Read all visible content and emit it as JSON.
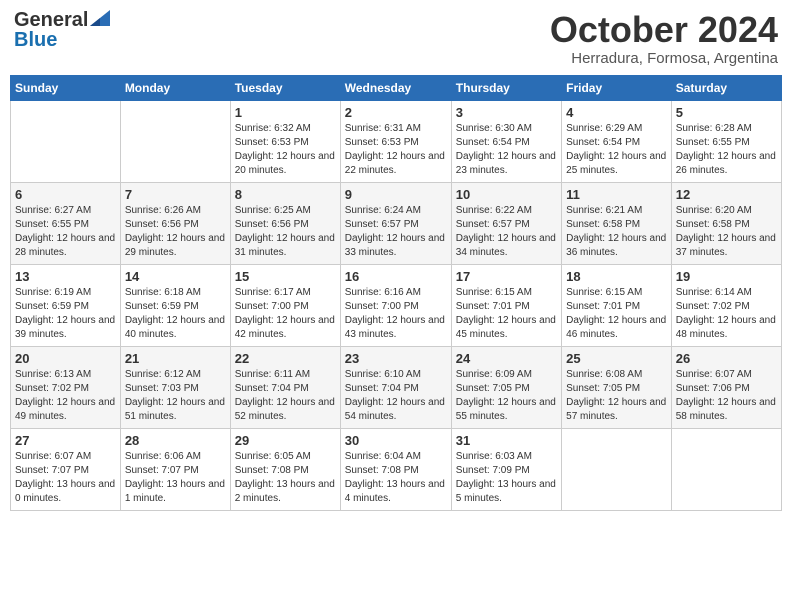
{
  "logo": {
    "general": "General",
    "blue": "Blue"
  },
  "title": "October 2024",
  "location": "Herradura, Formosa, Argentina",
  "weekdays": [
    "Sunday",
    "Monday",
    "Tuesday",
    "Wednesday",
    "Thursday",
    "Friday",
    "Saturday"
  ],
  "weeks": [
    [
      {
        "day": "",
        "empty": true
      },
      {
        "day": "",
        "empty": true
      },
      {
        "day": "1",
        "sunrise": "Sunrise: 6:32 AM",
        "sunset": "Sunset: 6:53 PM",
        "daylight": "Daylight: 12 hours and 20 minutes."
      },
      {
        "day": "2",
        "sunrise": "Sunrise: 6:31 AM",
        "sunset": "Sunset: 6:53 PM",
        "daylight": "Daylight: 12 hours and 22 minutes."
      },
      {
        "day": "3",
        "sunrise": "Sunrise: 6:30 AM",
        "sunset": "Sunset: 6:54 PM",
        "daylight": "Daylight: 12 hours and 23 minutes."
      },
      {
        "day": "4",
        "sunrise": "Sunrise: 6:29 AM",
        "sunset": "Sunset: 6:54 PM",
        "daylight": "Daylight: 12 hours and 25 minutes."
      },
      {
        "day": "5",
        "sunrise": "Sunrise: 6:28 AM",
        "sunset": "Sunset: 6:55 PM",
        "daylight": "Daylight: 12 hours and 26 minutes."
      }
    ],
    [
      {
        "day": "6",
        "sunrise": "Sunrise: 6:27 AM",
        "sunset": "Sunset: 6:55 PM",
        "daylight": "Daylight: 12 hours and 28 minutes."
      },
      {
        "day": "7",
        "sunrise": "Sunrise: 6:26 AM",
        "sunset": "Sunset: 6:56 PM",
        "daylight": "Daylight: 12 hours and 29 minutes."
      },
      {
        "day": "8",
        "sunrise": "Sunrise: 6:25 AM",
        "sunset": "Sunset: 6:56 PM",
        "daylight": "Daylight: 12 hours and 31 minutes."
      },
      {
        "day": "9",
        "sunrise": "Sunrise: 6:24 AM",
        "sunset": "Sunset: 6:57 PM",
        "daylight": "Daylight: 12 hours and 33 minutes."
      },
      {
        "day": "10",
        "sunrise": "Sunrise: 6:22 AM",
        "sunset": "Sunset: 6:57 PM",
        "daylight": "Daylight: 12 hours and 34 minutes."
      },
      {
        "day": "11",
        "sunrise": "Sunrise: 6:21 AM",
        "sunset": "Sunset: 6:58 PM",
        "daylight": "Daylight: 12 hours and 36 minutes."
      },
      {
        "day": "12",
        "sunrise": "Sunrise: 6:20 AM",
        "sunset": "Sunset: 6:58 PM",
        "daylight": "Daylight: 12 hours and 37 minutes."
      }
    ],
    [
      {
        "day": "13",
        "sunrise": "Sunrise: 6:19 AM",
        "sunset": "Sunset: 6:59 PM",
        "daylight": "Daylight: 12 hours and 39 minutes."
      },
      {
        "day": "14",
        "sunrise": "Sunrise: 6:18 AM",
        "sunset": "Sunset: 6:59 PM",
        "daylight": "Daylight: 12 hours and 40 minutes."
      },
      {
        "day": "15",
        "sunrise": "Sunrise: 6:17 AM",
        "sunset": "Sunset: 7:00 PM",
        "daylight": "Daylight: 12 hours and 42 minutes."
      },
      {
        "day": "16",
        "sunrise": "Sunrise: 6:16 AM",
        "sunset": "Sunset: 7:00 PM",
        "daylight": "Daylight: 12 hours and 43 minutes."
      },
      {
        "day": "17",
        "sunrise": "Sunrise: 6:15 AM",
        "sunset": "Sunset: 7:01 PM",
        "daylight": "Daylight: 12 hours and 45 minutes."
      },
      {
        "day": "18",
        "sunrise": "Sunrise: 6:15 AM",
        "sunset": "Sunset: 7:01 PM",
        "daylight": "Daylight: 12 hours and 46 minutes."
      },
      {
        "day": "19",
        "sunrise": "Sunrise: 6:14 AM",
        "sunset": "Sunset: 7:02 PM",
        "daylight": "Daylight: 12 hours and 48 minutes."
      }
    ],
    [
      {
        "day": "20",
        "sunrise": "Sunrise: 6:13 AM",
        "sunset": "Sunset: 7:02 PM",
        "daylight": "Daylight: 12 hours and 49 minutes."
      },
      {
        "day": "21",
        "sunrise": "Sunrise: 6:12 AM",
        "sunset": "Sunset: 7:03 PM",
        "daylight": "Daylight: 12 hours and 51 minutes."
      },
      {
        "day": "22",
        "sunrise": "Sunrise: 6:11 AM",
        "sunset": "Sunset: 7:04 PM",
        "daylight": "Daylight: 12 hours and 52 minutes."
      },
      {
        "day": "23",
        "sunrise": "Sunrise: 6:10 AM",
        "sunset": "Sunset: 7:04 PM",
        "daylight": "Daylight: 12 hours and 54 minutes."
      },
      {
        "day": "24",
        "sunrise": "Sunrise: 6:09 AM",
        "sunset": "Sunset: 7:05 PM",
        "daylight": "Daylight: 12 hours and 55 minutes."
      },
      {
        "day": "25",
        "sunrise": "Sunrise: 6:08 AM",
        "sunset": "Sunset: 7:05 PM",
        "daylight": "Daylight: 12 hours and 57 minutes."
      },
      {
        "day": "26",
        "sunrise": "Sunrise: 6:07 AM",
        "sunset": "Sunset: 7:06 PM",
        "daylight": "Daylight: 12 hours and 58 minutes."
      }
    ],
    [
      {
        "day": "27",
        "sunrise": "Sunrise: 6:07 AM",
        "sunset": "Sunset: 7:07 PM",
        "daylight": "Daylight: 13 hours and 0 minutes."
      },
      {
        "day": "28",
        "sunrise": "Sunrise: 6:06 AM",
        "sunset": "Sunset: 7:07 PM",
        "daylight": "Daylight: 13 hours and 1 minute."
      },
      {
        "day": "29",
        "sunrise": "Sunrise: 6:05 AM",
        "sunset": "Sunset: 7:08 PM",
        "daylight": "Daylight: 13 hours and 2 minutes."
      },
      {
        "day": "30",
        "sunrise": "Sunrise: 6:04 AM",
        "sunset": "Sunset: 7:08 PM",
        "daylight": "Daylight: 13 hours and 4 minutes."
      },
      {
        "day": "31",
        "sunrise": "Sunrise: 6:03 AM",
        "sunset": "Sunset: 7:09 PM",
        "daylight": "Daylight: 13 hours and 5 minutes."
      },
      {
        "day": "",
        "empty": true
      },
      {
        "day": "",
        "empty": true
      }
    ]
  ]
}
